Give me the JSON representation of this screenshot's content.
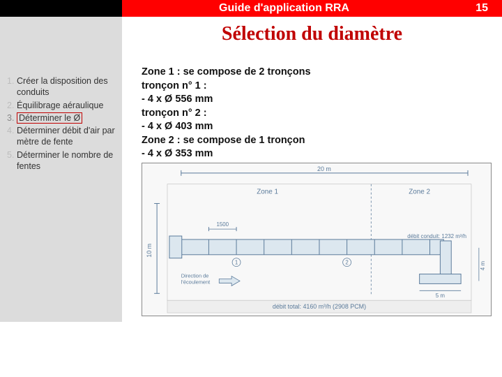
{
  "header": {
    "title": "Guide d'application RRA",
    "page_number": "15"
  },
  "page_title": "Sélection du diamètre",
  "sidebar": {
    "steps": [
      {
        "num": "1.",
        "text": "Créer la disposition des conduits"
      },
      {
        "num": "2.",
        "text": "Équilibrage aéraulique"
      },
      {
        "num": "3.",
        "text": "Déterminer le Ø"
      },
      {
        "num": "4.",
        "text": "Déterminer débit d'air par mètre de fente"
      },
      {
        "num": "5.",
        "text": "Déterminer le nombre de fentes"
      }
    ],
    "active_index": 2
  },
  "content": {
    "lines": [
      "Zone 1 : se compose de 2 tronçons",
      "tronçon n° 1 :",
      "- 4 x Ø 556 mm",
      "tronçon n° 2 :",
      "- 4 x Ø 403 mm",
      "Zone 2 : se compose de 1 tronçon",
      "- 4 x Ø 353 mm"
    ]
  },
  "diagram": {
    "top_dim": "20 m",
    "zone1_label": "Zone 1",
    "zone2_label": "Zone 2",
    "inner_dim": "1500",
    "left_dim": "10 m",
    "flow_label": "Direction de l'écoulement",
    "branch_debit": "débit conduit: 1232 m³/h",
    "right_h": "5 m",
    "right_v": "4 m",
    "footer": "débit total: 4160 m³/h (2908 PCM)",
    "segment_marks": [
      "1",
      "2"
    ]
  }
}
